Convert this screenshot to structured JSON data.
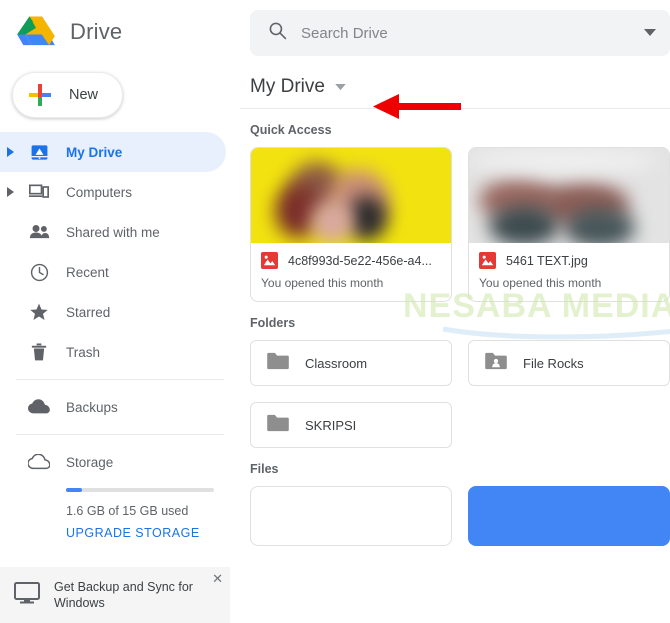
{
  "brand": {
    "title": "Drive",
    "logo_icon": "google-drive-logo"
  },
  "new_button": {
    "label": "New",
    "icon": "plus-icon"
  },
  "search": {
    "placeholder": "Search Drive",
    "value": "",
    "icon": "search-icon",
    "dropdown_icon": "chevron-down-icon"
  },
  "sidebar": {
    "items": [
      {
        "label": "My Drive",
        "icon": "my-drive-icon",
        "active": true,
        "expandable": true
      },
      {
        "label": "Computers",
        "icon": "computers-icon",
        "active": false,
        "expandable": true
      },
      {
        "label": "Shared with me",
        "icon": "people-icon",
        "active": false,
        "expandable": false
      },
      {
        "label": "Recent",
        "icon": "clock-icon",
        "active": false,
        "expandable": false
      },
      {
        "label": "Starred",
        "icon": "star-icon",
        "active": false,
        "expandable": false
      },
      {
        "label": "Trash",
        "icon": "trash-icon",
        "active": false,
        "expandable": false
      },
      {
        "label": "Backups",
        "icon": "cloud-filled-icon",
        "active": false,
        "expandable": false
      }
    ],
    "storage": {
      "label": "Storage",
      "icon": "cloud-outline-icon",
      "used_text": "1.6 GB of 15 GB used",
      "upgrade_label": "UPGRADE STORAGE",
      "percent_used": 11
    },
    "promo": {
      "text": "Get Backup and Sync for Windows",
      "icon": "monitor-icon",
      "close_icon": "close-icon"
    }
  },
  "main": {
    "breadcrumb": {
      "label": "My Drive",
      "dropdown_icon": "caret-down-icon"
    },
    "quick_access": {
      "title": "Quick Access",
      "cards": [
        {
          "name": "4c8f993d-5e22-456e-a4...",
          "subtitle": "You opened this month",
          "icon": "image-file-icon",
          "thumb": "yellow"
        },
        {
          "name": "5461 TEXT.jpg",
          "subtitle": "You opened this month",
          "icon": "image-file-icon",
          "thumb": "grey"
        }
      ]
    },
    "folders": {
      "title": "Folders",
      "items": [
        {
          "name": "Classroom",
          "icon": "folder-icon"
        },
        {
          "name": "File Rocks",
          "icon": "shared-folder-icon"
        },
        {
          "name": "SKRIPSI",
          "icon": "folder-icon"
        }
      ]
    },
    "files": {
      "title": "Files",
      "items": [
        {
          "name": "",
          "selected": false
        },
        {
          "name": "",
          "selected": true
        }
      ]
    }
  },
  "annotation": {
    "arrow_icon": "left-arrow-annotation",
    "color": "#ee0000"
  },
  "watermark": {
    "line1": "NESABA MEDIA"
  },
  "colors": {
    "accent_blue": "#1a73e8",
    "selected_blue": "#4285f4",
    "active_bg": "#e8f0fe",
    "text_grey": "#5f6368",
    "search_bg": "#f1f3f4"
  }
}
